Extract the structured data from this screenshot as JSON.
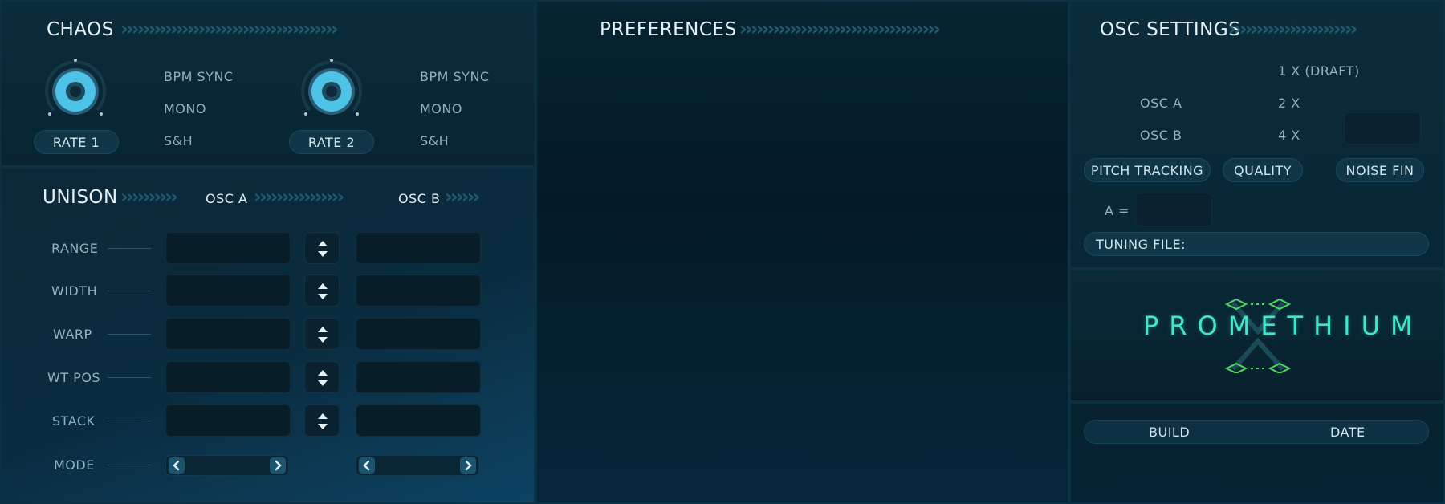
{
  "chaos": {
    "title": "CHAOS",
    "rate1": {
      "label": "RATE 1",
      "options": [
        "BPM SYNC",
        "MONO",
        "S&H"
      ]
    },
    "rate2": {
      "label": "RATE 2",
      "options": [
        "BPM SYNC",
        "MONO",
        "S&H"
      ]
    }
  },
  "unison": {
    "title": "UNISON",
    "osc_a": "OSC A",
    "osc_b": "OSC B",
    "rows": [
      "RANGE",
      "WIDTH",
      "WARP",
      "WT POS",
      "STACK"
    ],
    "mode": "MODE"
  },
  "preferences": {
    "title": "PREFERENCES"
  },
  "osc_settings": {
    "title": "OSC SETTINGS",
    "quality_options": [
      "1 X (DRAFT)",
      "2 X",
      "4 X"
    ],
    "osc_a": "OSC A",
    "osc_b": "OSC B",
    "pitch_tracking": "PITCH TRACKING",
    "quality": "QUALITY",
    "noise_fin": "NOISE FIN",
    "a_label": "A =",
    "tuning_file": "TUNING FILE:"
  },
  "logo": {
    "text": "PROMETHIUM"
  },
  "build": {
    "build_label": "BUILD",
    "date_label": "DATE"
  },
  "colors": {
    "accent": "#4ec3e8",
    "logo": "#3fe6cc",
    "background": "#021620"
  }
}
